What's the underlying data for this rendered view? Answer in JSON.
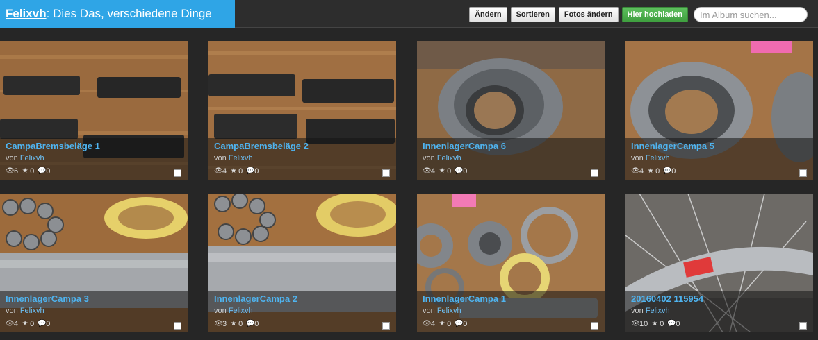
{
  "header": {
    "owner": "Felixvh",
    "separator": ":",
    "album_title": "Dies Das, verschiedene Dinge",
    "colors": {
      "accent": "#2fa5e6",
      "bar": "#2d2d2d",
      "upload": "#4caf50"
    }
  },
  "toolbar": {
    "edit_label": "Ändern",
    "sort_label": "Sortieren",
    "edit_photos_label": "Fotos ändern",
    "upload_label": "Hier hochladen",
    "search_placeholder": "Im Album suchen..."
  },
  "byline_prefix": "von",
  "icons": {
    "views": "eye-icon",
    "rating": "star-icon",
    "comments": "comment-icon",
    "select": "checkbox"
  },
  "photos": [
    {
      "title": "CampaBremsbeläge 1",
      "user": "Felixvh",
      "views": "6",
      "rating": "0",
      "comments": "0",
      "scene": "brakepads-1"
    },
    {
      "title": "CampaBremsbeläge 2",
      "user": "Felixvh",
      "views": "4",
      "rating": "0",
      "comments": "0",
      "scene": "brakepads-2"
    },
    {
      "title": "InnenlagerCampa 6",
      "user": "Felixvh",
      "views": "4",
      "rating": "0",
      "comments": "0",
      "scene": "bearing-cup-1"
    },
    {
      "title": "InnenlagerCampa 5",
      "user": "Felixvh",
      "views": "4",
      "rating": "0",
      "comments": "0",
      "scene": "bearing-cup-2"
    },
    {
      "title": "InnenlagerCampa 3",
      "user": "Felixvh",
      "views": "4",
      "rating": "0",
      "comments": "0",
      "scene": "axle-balls-1"
    },
    {
      "title": "InnenlagerCampa 2",
      "user": "Felixvh",
      "views": "3",
      "rating": "0",
      "comments": "0",
      "scene": "axle-balls-2"
    },
    {
      "title": "InnenlagerCampa 1",
      "user": "Felixvh",
      "views": "4",
      "rating": "0",
      "comments": "0",
      "scene": "bearing-parts"
    },
    {
      "title": "20160402 115954",
      "user": "Felixvh",
      "views": "10",
      "rating": "0",
      "comments": "0",
      "scene": "wheel-rim"
    }
  ]
}
